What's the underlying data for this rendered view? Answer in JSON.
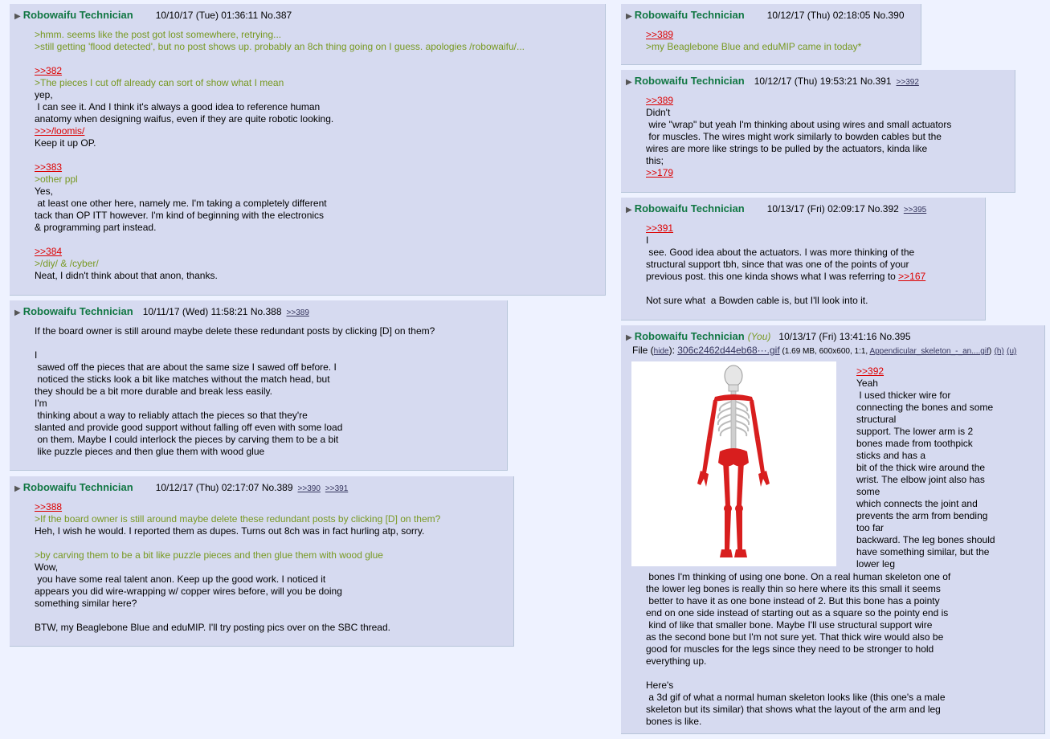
{
  "posts": [
    {
      "name": "Robowaifu Technician",
      "date": "10/10/17 (Tue) 01:36:11",
      "no": "No.387",
      "backlinks": [],
      "lines": [
        {
          "t": ">hmm. seems like the post got lost somewhere, retrying...",
          "c": "gt"
        },
        {
          "t": ">still getting 'flood detected', but no post shows up. probably an 8ch thing going on I guess. apologies /robowaifu/...",
          "c": "gt"
        },
        {
          "t": "",
          "c": ""
        },
        {
          "t": ">>382",
          "c": "q"
        },
        {
          "t": ">The pieces I cut off already can sort of show what I mean",
          "c": "gt"
        },
        {
          "t": "yep,",
          "c": ""
        },
        {
          "t": " I can see it. And I think it's always a good idea to reference human",
          "c": ""
        },
        {
          "t": "anatomy when designing waifus, even if they are quite robotic looking.",
          "c": ""
        },
        {
          "t": ">>>/loomis/",
          "c": "q"
        },
        {
          "t": "Keep it up OP.",
          "c": ""
        },
        {
          "t": "",
          "c": ""
        },
        {
          "t": ">>383",
          "c": "q"
        },
        {
          "t": ">other ppl",
          "c": "gt"
        },
        {
          "t": "Yes,",
          "c": ""
        },
        {
          "t": " at least one other here, namely me. I'm taking a completely different",
          "c": ""
        },
        {
          "t": "tack than OP ITT however. I'm kind of beginning with the electronics",
          "c": ""
        },
        {
          "t": "& programming part instead.",
          "c": ""
        },
        {
          "t": "",
          "c": ""
        },
        {
          "t": ">>384",
          "c": "q"
        },
        {
          "t": ">/diy/ & /cyber/",
          "c": "gt"
        },
        {
          "t": "Neat, I didn't think about that anon, thanks.",
          "c": ""
        }
      ]
    },
    {
      "name": "Robowaifu Technician",
      "date": "10/11/17 (Wed) 11:58:21",
      "no": "No.388",
      "backlinks": [
        ">>389"
      ],
      "lines": [
        {
          "t": "If the board owner is still around maybe delete these redundant posts by clicking [D] on them?",
          "c": ""
        },
        {
          "t": "",
          "c": ""
        },
        {
          "t": "I",
          "c": ""
        },
        {
          "t": " sawed off the pieces that are about the same size I sawed off before. I",
          "c": ""
        },
        {
          "t": " noticed the sticks look a bit like matches without the match head, but",
          "c": ""
        },
        {
          "t": "they should be a bit more durable and break less easily.",
          "c": ""
        },
        {
          "t": "I'm",
          "c": ""
        },
        {
          "t": " thinking about a way to reliably attach the pieces so that they're",
          "c": ""
        },
        {
          "t": "slanted and provide good support without falling off even with some load",
          "c": ""
        },
        {
          "t": " on them. Maybe I could interlock the pieces by carving them to be a bit",
          "c": ""
        },
        {
          "t": " like puzzle pieces and then glue them with wood glue",
          "c": ""
        }
      ]
    },
    {
      "name": "Robowaifu Technician",
      "date": "10/12/17 (Thu) 02:17:07",
      "no": "No.389",
      "backlinks": [
        ">>390",
        ">>391"
      ],
      "lines": [
        {
          "t": ">>388",
          "c": "q"
        },
        {
          "t": ">If the board owner is still around maybe delete these redundant posts by clicking [D] on them?",
          "c": "gt"
        },
        {
          "t": "Heh, I wish he would. I reported them as dupes. Turns out 8ch was in fact hurling atp, sorry.",
          "c": ""
        },
        {
          "t": "",
          "c": ""
        },
        {
          "t": ">by carving them to be a bit like puzzle pieces and then glue them with wood glue",
          "c": "gt"
        },
        {
          "t": "Wow,",
          "c": ""
        },
        {
          "t": " you have some real talent anon. Keep up the good work. I noticed it",
          "c": ""
        },
        {
          "t": "appears you did wire-wrapping w/ copper wires before, will you be doing",
          "c": ""
        },
        {
          "t": "something similar here?",
          "c": ""
        },
        {
          "t": "",
          "c": ""
        },
        {
          "t": "BTW, my Beaglebone Blue and eduMIP. I'll try posting pics over on the SBC thread.",
          "c": ""
        }
      ]
    },
    {
      "name": "Robowaifu Technician",
      "date": "10/12/17 (Thu) 02:18:05",
      "no": "No.390",
      "backlinks": [],
      "lines": [
        {
          "t": ">>389",
          "c": "q"
        },
        {
          "t": ">my Beaglebone Blue and eduMIP came in today*",
          "c": "gt"
        }
      ]
    },
    {
      "name": "Robowaifu Technician",
      "date": "10/12/17 (Thu) 19:53:21",
      "no": "No.391",
      "backlinks": [
        ">>392"
      ],
      "lines": [
        {
          "t": ">>389",
          "c": "q"
        },
        {
          "t": "Didn't",
          "c": ""
        },
        {
          "t": " wire \"wrap\" but yeah I'm thinking about using wires and small actuators",
          "c": ""
        },
        {
          "t": " for muscles. The wires might work similarly to bowden cables but the",
          "c": ""
        },
        {
          "t": "wires are more like strings to be pulled by the actuators, kinda like",
          "c": ""
        },
        {
          "t": "this;",
          "c": ""
        },
        {
          "t": ">>179",
          "c": "q"
        }
      ]
    },
    {
      "name": "Robowaifu Technician",
      "date": "10/13/17 (Fri) 02:09:17",
      "no": "No.392",
      "backlinks": [
        ">>395"
      ],
      "lines": [
        {
          "t": ">>391",
          "c": "q"
        },
        {
          "t": "I",
          "c": ""
        },
        {
          "t": " see. Good idea about the actuators. I was more thinking of the",
          "c": ""
        },
        {
          "t": "structural support tbh, since that was one of the points of your",
          "c": ""
        },
        {
          "t": "previous post. this one kinda shows what I was referring to ",
          "c": "",
          "link": ">>167"
        },
        {
          "t": "",
          "c": ""
        },
        {
          "t": "Not sure what  a Bowden cable is, but I'll look into it.",
          "c": ""
        }
      ]
    },
    {
      "name": "Robowaifu Technician",
      "you": "(You)",
      "date": "10/13/17 (Fri) 13:41:16",
      "no": "No.395",
      "backlinks": [],
      "file": {
        "label": "File (",
        "hide": "hide",
        "close": "): ",
        "name": "306c2462d44eb68···.gif",
        "meta": " (1.69 MB, 600x600, 1:1, ",
        "orig": "Appendicular_skeleton_-_an....gif",
        "end": ")",
        "h": "(h)",
        "u": "(u)"
      },
      "side": [
        {
          "t": ">>392",
          "c": "q"
        },
        {
          "t": "Yeah",
          "c": ""
        },
        {
          "t": " I used thicker wire for",
          "c": ""
        },
        {
          "t": "connecting the bones and some",
          "c": ""
        },
        {
          "t": "structural",
          "c": ""
        },
        {
          "t": "support. The lower arm is 2",
          "c": ""
        },
        {
          "t": "bones made from toothpick",
          "c": ""
        },
        {
          "t": "sticks and has a",
          "c": ""
        },
        {
          "t": "bit of the thick wire around the",
          "c": ""
        },
        {
          "t": "wrist. The elbow joint also has",
          "c": ""
        },
        {
          "t": "some",
          "c": ""
        },
        {
          "t": "which connects the joint and",
          "c": ""
        },
        {
          "t": "prevents the arm from bending",
          "c": ""
        },
        {
          "t": "too far",
          "c": ""
        },
        {
          "t": "backward. The leg bones should",
          "c": ""
        },
        {
          "t": "have something similar, but the",
          "c": ""
        },
        {
          "t": "lower leg",
          "c": ""
        }
      ],
      "below": [
        {
          "t": " bones I'm thinking of using one bone. On a real human skeleton one of",
          "c": ""
        },
        {
          "t": "the lower leg bones is really thin so here where its this small it seems",
          "c": ""
        },
        {
          "t": " better to have it as one bone instead of 2. But this bone has a pointy",
          "c": ""
        },
        {
          "t": "end on one side instead of starting out as a square so the pointy end is",
          "c": ""
        },
        {
          "t": " kind of like that smaller bone. Maybe I'll use structural support wire",
          "c": ""
        },
        {
          "t": "as the second bone but I'm not sure yet. That thick wire would also be",
          "c": ""
        },
        {
          "t": "good for muscles for the legs since they need to be stronger to hold",
          "c": ""
        },
        {
          "t": "everything up.",
          "c": ""
        },
        {
          "t": "",
          "c": ""
        },
        {
          "t": "Here's",
          "c": ""
        },
        {
          "t": " a 3d gif of what a normal human skeleton looks like (this one's a male",
          "c": ""
        },
        {
          "t": "skeleton but its similar) that shows what the layout of the arm and leg",
          "c": ""
        },
        {
          "t": "bones is like.",
          "c": ""
        }
      ]
    }
  ]
}
